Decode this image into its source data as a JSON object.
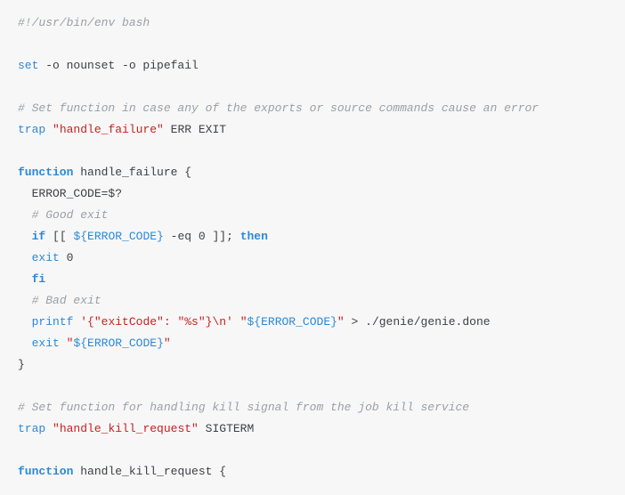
{
  "code": {
    "lines": [
      {
        "tokens": [
          {
            "cls": "tok-comment",
            "text": "#!/usr/bin/env bash"
          }
        ]
      },
      {
        "tokens": []
      },
      {
        "tokens": [
          {
            "cls": "tok-builtin",
            "text": "set"
          },
          {
            "cls": "tok-plain",
            "text": " -o nounset -o pipefail"
          }
        ]
      },
      {
        "tokens": []
      },
      {
        "tokens": [
          {
            "cls": "tok-comment",
            "text": "# Set function in case any of the exports or source commands cause an error"
          }
        ]
      },
      {
        "tokens": [
          {
            "cls": "tok-builtin",
            "text": "trap"
          },
          {
            "cls": "tok-plain",
            "text": " "
          },
          {
            "cls": "tok-string",
            "text": "\"handle_failure\""
          },
          {
            "cls": "tok-plain",
            "text": " ERR EXIT"
          }
        ]
      },
      {
        "tokens": []
      },
      {
        "tokens": [
          {
            "cls": "tok-keyword",
            "text": "function"
          },
          {
            "cls": "tok-plain",
            "text": " "
          },
          {
            "cls": "tok-fnname",
            "text": "handle_failure"
          },
          {
            "cls": "tok-plain",
            "text": " {"
          }
        ]
      },
      {
        "tokens": [
          {
            "cls": "tok-plain",
            "text": "  ERROR_CODE=$?"
          }
        ]
      },
      {
        "tokens": [
          {
            "cls": "tok-plain",
            "text": "  "
          },
          {
            "cls": "tok-comment",
            "text": "# Good exit"
          }
        ]
      },
      {
        "tokens": [
          {
            "cls": "tok-plain",
            "text": "  "
          },
          {
            "cls": "tok-keyword",
            "text": "if"
          },
          {
            "cls": "tok-plain",
            "text": " [[ "
          },
          {
            "cls": "tok-var",
            "text": "${ERROR_CODE}"
          },
          {
            "cls": "tok-plain",
            "text": " -eq 0 ]]; "
          },
          {
            "cls": "tok-keyword",
            "text": "then"
          }
        ]
      },
      {
        "tokens": [
          {
            "cls": "tok-plain",
            "text": "  "
          },
          {
            "cls": "tok-builtin",
            "text": "exit"
          },
          {
            "cls": "tok-plain",
            "text": " 0"
          }
        ]
      },
      {
        "tokens": [
          {
            "cls": "tok-plain",
            "text": "  "
          },
          {
            "cls": "tok-keyword",
            "text": "fi"
          }
        ]
      },
      {
        "tokens": [
          {
            "cls": "tok-plain",
            "text": "  "
          },
          {
            "cls": "tok-comment",
            "text": "# Bad exit"
          }
        ]
      },
      {
        "tokens": [
          {
            "cls": "tok-plain",
            "text": "  "
          },
          {
            "cls": "tok-builtin",
            "text": "printf"
          },
          {
            "cls": "tok-plain",
            "text": " "
          },
          {
            "cls": "tok-string",
            "text": "'{\"exitCode\": \"%s\"}\\n'"
          },
          {
            "cls": "tok-plain",
            "text": " "
          },
          {
            "cls": "tok-string",
            "text": "\""
          },
          {
            "cls": "tok-var",
            "text": "${ERROR_CODE}"
          },
          {
            "cls": "tok-string",
            "text": "\""
          },
          {
            "cls": "tok-plain",
            "text": " > ./genie/genie.done"
          }
        ]
      },
      {
        "tokens": [
          {
            "cls": "tok-plain",
            "text": "  "
          },
          {
            "cls": "tok-builtin",
            "text": "exit"
          },
          {
            "cls": "tok-plain",
            "text": " "
          },
          {
            "cls": "tok-string",
            "text": "\""
          },
          {
            "cls": "tok-var",
            "text": "${ERROR_CODE}"
          },
          {
            "cls": "tok-string",
            "text": "\""
          }
        ]
      },
      {
        "tokens": [
          {
            "cls": "tok-plain",
            "text": "}"
          }
        ]
      },
      {
        "tokens": []
      },
      {
        "tokens": [
          {
            "cls": "tok-comment",
            "text": "# Set function for handling kill signal from the job kill service"
          }
        ]
      },
      {
        "tokens": [
          {
            "cls": "tok-builtin",
            "text": "trap"
          },
          {
            "cls": "tok-plain",
            "text": " "
          },
          {
            "cls": "tok-string",
            "text": "\"handle_kill_request\""
          },
          {
            "cls": "tok-plain",
            "text": " SIGTERM"
          }
        ]
      },
      {
        "tokens": []
      },
      {
        "tokens": [
          {
            "cls": "tok-keyword",
            "text": "function"
          },
          {
            "cls": "tok-plain",
            "text": " "
          },
          {
            "cls": "tok-fnname",
            "text": "handle_kill_request"
          },
          {
            "cls": "tok-plain",
            "text": " {"
          }
        ]
      }
    ]
  }
}
